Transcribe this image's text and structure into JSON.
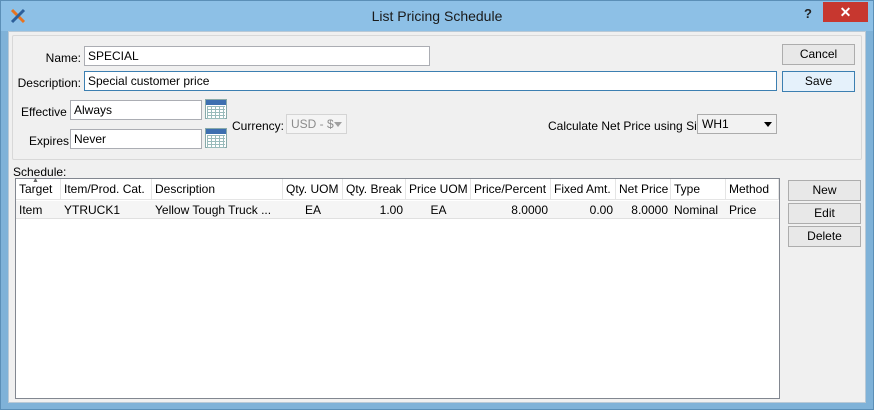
{
  "window": {
    "title": "List Pricing Schedule",
    "help_label": "?",
    "close_label": "✕"
  },
  "form": {
    "name_label": "Name:",
    "name_value": "SPECIAL",
    "description_label": "Description:",
    "description_value": "Special customer price",
    "effective_label": "Effective",
    "effective_value": "Always",
    "expires_label": "Expires",
    "expires_value": "Never",
    "currency_label": "Currency:",
    "currency_value": "USD - $",
    "site_label": "Calculate Net Price using Site:",
    "site_value": "WH1"
  },
  "buttons": {
    "cancel": "Cancel",
    "save": "Save",
    "new": "New",
    "edit": "Edit",
    "delete": "Delete"
  },
  "schedule": {
    "label": "Schedule:",
    "columns": [
      "Target",
      "Item/Prod. Cat.",
      "Description",
      "Qty. UOM",
      "Qty. Break",
      "Price UOM",
      "Price/Percent",
      "Fixed Amt.",
      "Net Price",
      "Type",
      "Method"
    ],
    "rows": [
      [
        "Item",
        "YTRUCK1",
        "Yellow Tough Truck ...",
        "EA",
        "1.00",
        "EA",
        "8.0000",
        "0.00",
        "8.0000",
        "Nominal",
        "Price"
      ]
    ]
  },
  "colors": {
    "titlebar": "#8dc0e6",
    "close": "#c7372f",
    "accent": "#3c7fb1"
  },
  "icons": {
    "app": "xtuple-x-icon",
    "calendar": "calendar-icon"
  }
}
